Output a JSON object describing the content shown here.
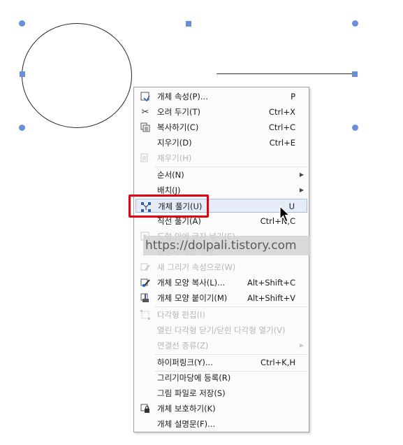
{
  "menu": {
    "items": [
      {
        "label": "개체 속성(P)...",
        "shortcut": "P",
        "icon": "properties-icon",
        "disabled": false
      },
      {
        "label": "오려 두기(T)",
        "shortcut": "Ctrl+X",
        "icon": "scissors-icon",
        "disabled": false
      },
      {
        "label": "복사하기(C)",
        "shortcut": "Ctrl+C",
        "icon": "copy-icon",
        "disabled": false
      },
      {
        "label": "지우기(D)",
        "shortcut": "Ctrl+E",
        "icon": "",
        "disabled": false
      },
      {
        "label": "채우기(H)",
        "shortcut": "",
        "icon": "fill-icon",
        "disabled": true
      },
      {
        "label": "순서(N)",
        "shortcut": "",
        "icon": "",
        "disabled": false,
        "submenu": true
      },
      {
        "label": "배치(J)",
        "shortcut": "",
        "icon": "",
        "disabled": false,
        "submenu": true
      },
      {
        "label": "개체 풀기(U)",
        "shortcut": "U",
        "icon": "ungroup-icon",
        "disabled": false,
        "highlighted": true
      },
      {
        "label": "직선 풀기(A)",
        "shortcut": "Ctrl+N,C",
        "icon": "",
        "disabled": false
      },
      {
        "label": "도형 안에 글자 넣기(E)",
        "shortcut": "",
        "icon": "text-in-shape-icon",
        "disabled": true
      },
      {
        "label": "글상자 속성 변경",
        "shortcut": "",
        "icon": "",
        "disabled": true
      },
      {
        "label": "새 그리기 속성으로(W)",
        "shortcut": "",
        "icon": "draw-style-icon",
        "disabled": true
      },
      {
        "label": "개체 모양 복사(L)...",
        "shortcut": "Alt+Shift+C",
        "icon": "style-copy-icon",
        "disabled": false
      },
      {
        "label": "개체 모양 붙이기(M)",
        "shortcut": "Alt+Shift+V",
        "icon": "style-paste-icon",
        "disabled": false
      },
      {
        "label": "다각형 편집(I)",
        "shortcut": "",
        "icon": "polygon-edit-icon",
        "disabled": true
      },
      {
        "label": "열린 다각형 닫기/닫힌 다각형 열기(V)",
        "shortcut": "",
        "icon": "",
        "disabled": true
      },
      {
        "label": "연결선 종류(Z)",
        "shortcut": "",
        "icon": "",
        "disabled": true,
        "submenu": true
      },
      {
        "label": "하이퍼링크(Y)...",
        "shortcut": "Ctrl+K,H",
        "icon": "",
        "disabled": false
      },
      {
        "label": "그리기마당에 등록(R)",
        "shortcut": "",
        "icon": "",
        "disabled": false
      },
      {
        "label": "그림 파일로 저장(S)",
        "shortcut": "",
        "icon": "",
        "disabled": false
      },
      {
        "label": "개체 보호하기(K)",
        "shortcut": "",
        "icon": "lock-icon",
        "disabled": false
      },
      {
        "label": "개체 설명문(F)...",
        "shortcut": "",
        "icon": "",
        "disabled": false
      }
    ]
  },
  "watermark": "https://dolpali.tistory.com",
  "colors": {
    "handle": "#6a8fd6",
    "highlight_box": "#e60012",
    "menu_highlight": "#e6ecf6"
  }
}
